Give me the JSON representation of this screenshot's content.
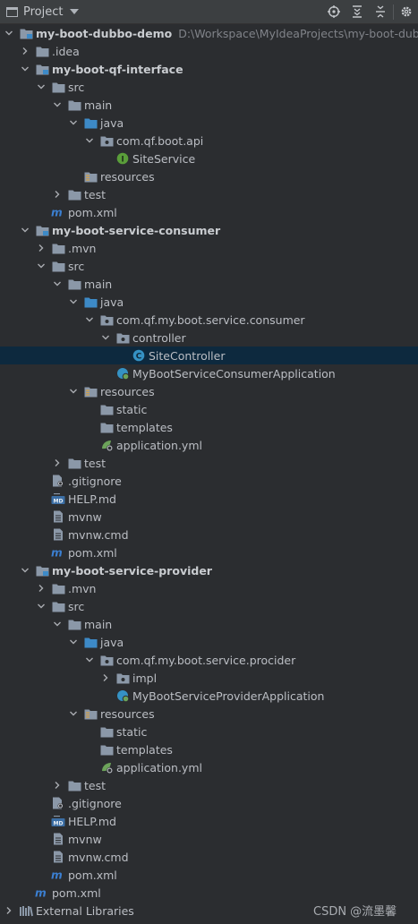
{
  "header": {
    "title": "Project",
    "icons": [
      "locate-icon",
      "expand-all-icon",
      "collapse-all-icon",
      "settings-gear-icon"
    ]
  },
  "tree": [
    {
      "d": 0,
      "a": "down",
      "i": "module",
      "t": "my-boot-dubbo-demo",
      "b": true,
      "p": "D:\\Workspace\\MyIdeaProjects\\my-boot-dubbo-demo"
    },
    {
      "d": 1,
      "a": "right",
      "i": "folder",
      "t": ".idea"
    },
    {
      "d": 1,
      "a": "down",
      "i": "module",
      "t": "my-boot-qf-interface",
      "b": true
    },
    {
      "d": 2,
      "a": "down",
      "i": "folder",
      "t": "src"
    },
    {
      "d": 3,
      "a": "down",
      "i": "folder",
      "t": "main"
    },
    {
      "d": 4,
      "a": "down",
      "i": "folder-src",
      "t": "java"
    },
    {
      "d": 5,
      "a": "down",
      "i": "package",
      "t": "com.qf.boot.api"
    },
    {
      "d": 6,
      "a": "none",
      "i": "interface",
      "t": "SiteService"
    },
    {
      "d": 4,
      "a": "none",
      "i": "folder-res",
      "t": "resources"
    },
    {
      "d": 3,
      "a": "right",
      "i": "folder",
      "t": "test"
    },
    {
      "d": 2,
      "a": "none",
      "i": "maven",
      "t": "pom.xml"
    },
    {
      "d": 1,
      "a": "down",
      "i": "module",
      "t": "my-boot-service-consumer",
      "b": true
    },
    {
      "d": 2,
      "a": "right",
      "i": "folder",
      "t": ".mvn"
    },
    {
      "d": 2,
      "a": "down",
      "i": "folder",
      "t": "src"
    },
    {
      "d": 3,
      "a": "down",
      "i": "folder",
      "t": "main"
    },
    {
      "d": 4,
      "a": "down",
      "i": "folder-src",
      "t": "java"
    },
    {
      "d": 5,
      "a": "down",
      "i": "package",
      "t": "com.qf.my.boot.service.consumer"
    },
    {
      "d": 6,
      "a": "down",
      "i": "package",
      "t": "controller"
    },
    {
      "d": 7,
      "a": "none",
      "i": "class",
      "t": "SiteController",
      "s": true
    },
    {
      "d": 6,
      "a": "none",
      "i": "springboot",
      "t": "MyBootServiceConsumerApplication"
    },
    {
      "d": 4,
      "a": "down",
      "i": "folder-res",
      "t": "resources"
    },
    {
      "d": 5,
      "a": "none",
      "i": "folder",
      "t": "static"
    },
    {
      "d": 5,
      "a": "none",
      "i": "folder",
      "t": "templates"
    },
    {
      "d": 5,
      "a": "none",
      "i": "yml",
      "t": "application.yml"
    },
    {
      "d": 3,
      "a": "right",
      "i": "folder",
      "t": "test"
    },
    {
      "d": 2,
      "a": "none",
      "i": "gitignore",
      "t": ".gitignore"
    },
    {
      "d": 2,
      "a": "none",
      "i": "md",
      "t": "HELP.md"
    },
    {
      "d": 2,
      "a": "none",
      "i": "file",
      "t": "mvnw"
    },
    {
      "d": 2,
      "a": "none",
      "i": "file",
      "t": "mvnw.cmd"
    },
    {
      "d": 2,
      "a": "none",
      "i": "maven",
      "t": "pom.xml"
    },
    {
      "d": 1,
      "a": "down",
      "i": "module",
      "t": "my-boot-service-provider",
      "b": true
    },
    {
      "d": 2,
      "a": "right",
      "i": "folder",
      "t": ".mvn"
    },
    {
      "d": 2,
      "a": "down",
      "i": "folder",
      "t": "src"
    },
    {
      "d": 3,
      "a": "down",
      "i": "folder",
      "t": "main"
    },
    {
      "d": 4,
      "a": "down",
      "i": "folder-src",
      "t": "java"
    },
    {
      "d": 5,
      "a": "down",
      "i": "package",
      "t": "com.qf.my.boot.service.procider"
    },
    {
      "d": 6,
      "a": "right",
      "i": "package",
      "t": "impl"
    },
    {
      "d": 6,
      "a": "none",
      "i": "springboot",
      "t": "MyBootServiceProviderApplication"
    },
    {
      "d": 4,
      "a": "down",
      "i": "folder-res",
      "t": "resources"
    },
    {
      "d": 5,
      "a": "none",
      "i": "folder",
      "t": "static"
    },
    {
      "d": 5,
      "a": "none",
      "i": "folder",
      "t": "templates"
    },
    {
      "d": 5,
      "a": "none",
      "i": "yml",
      "t": "application.yml"
    },
    {
      "d": 3,
      "a": "right",
      "i": "folder",
      "t": "test"
    },
    {
      "d": 2,
      "a": "none",
      "i": "gitignore",
      "t": ".gitignore"
    },
    {
      "d": 2,
      "a": "none",
      "i": "md",
      "t": "HELP.md"
    },
    {
      "d": 2,
      "a": "none",
      "i": "file",
      "t": "mvnw"
    },
    {
      "d": 2,
      "a": "none",
      "i": "file",
      "t": "mvnw.cmd"
    },
    {
      "d": 2,
      "a": "none",
      "i": "maven",
      "t": "pom.xml"
    },
    {
      "d": 1,
      "a": "none",
      "i": "maven",
      "t": "pom.xml"
    },
    {
      "d": 0,
      "a": "right",
      "i": "libraries",
      "t": "External Libraries"
    }
  ],
  "watermark": {
    "prefix": "CSDN",
    "name": "@流墨馨"
  },
  "colors": {
    "background": "#2b2d30",
    "selection": "#0d293e",
    "folder": "#8b98a8",
    "source_folder": "#3d8ac7",
    "interface": "#5a9e3a",
    "class": "#3592c4",
    "maven": "#3b7fd1"
  }
}
